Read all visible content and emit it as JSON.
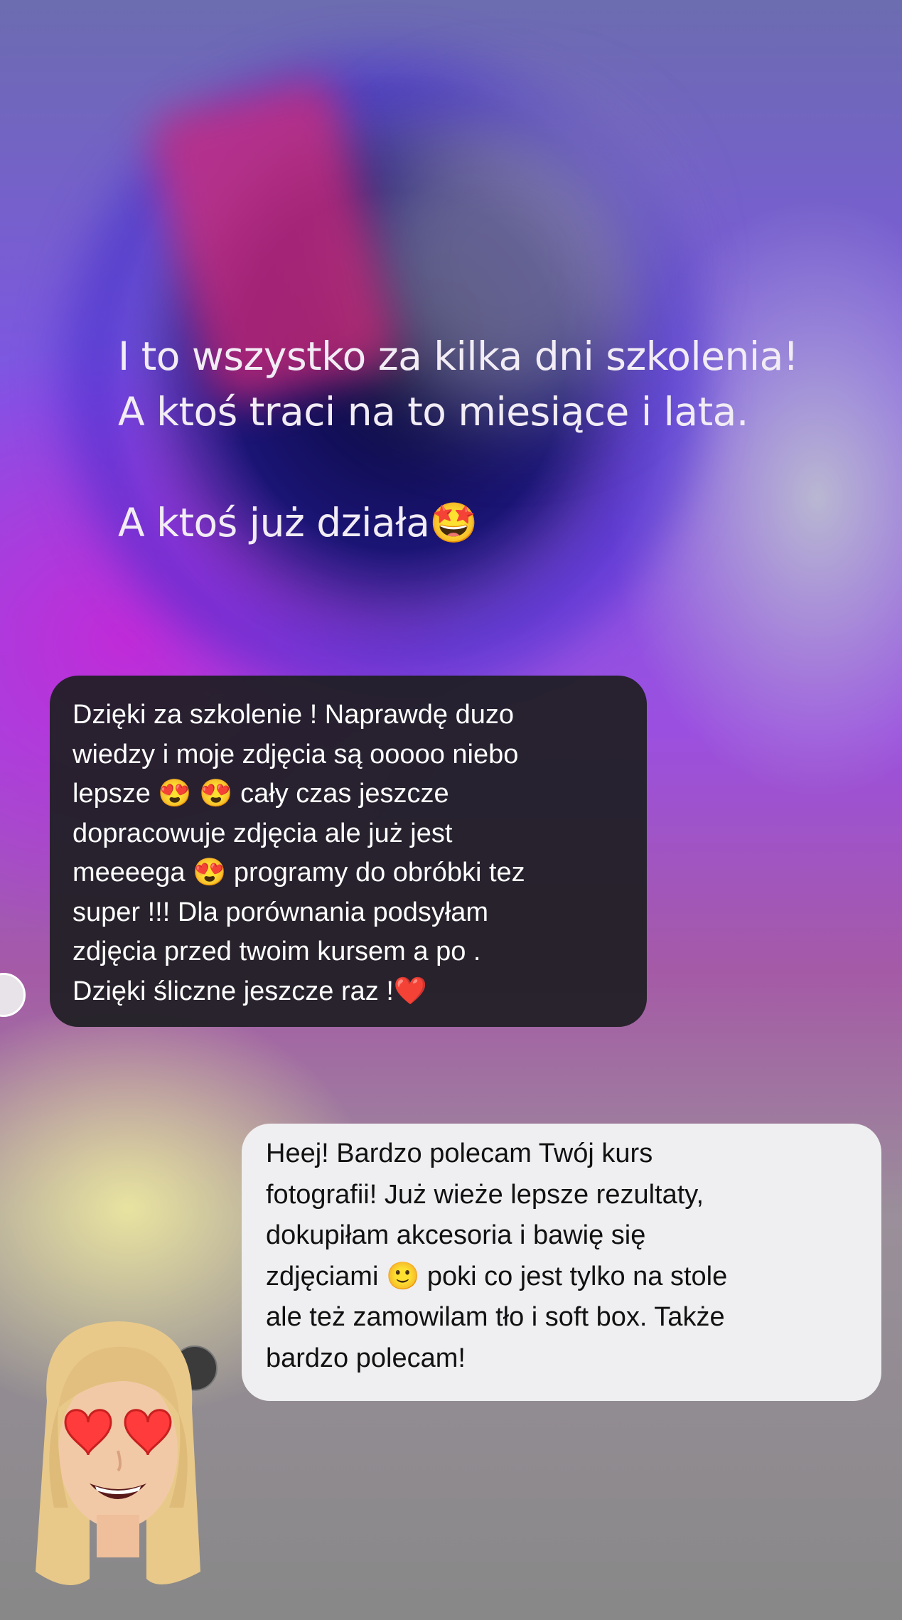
{
  "story": {
    "line1": "I to wszystko za kilka dni szkolenia!",
    "line2": "A ktoś traci na to miesiące i lata.",
    "line3": "A ktoś już działa🤩"
  },
  "message_received": {
    "lines": [
      "Dzięki za szkolenie ! Naprawdę duzo",
      "wiedzy i moje zdjęcia są ooooo niebo",
      "lepsze 😍 😍 cały czas jeszcze",
      "dopracowuje zdjęcia ale już jest",
      "meeeega 😍 programy do obróbki tez",
      "super !!! Dla porównania podsyłam",
      "zdjęcia przed twoim kursem a po .",
      "Dzięki śliczne jeszcze raz !❤️"
    ]
  },
  "message_reply": {
    "lines": [
      "Heej! Bardzo polecam Twój kurs",
      "fotografii! Już wieże lepsze rezultaty,",
      "dokupiłam akcesoria i bawię się",
      "zdjęciami 🙂 poki co jest tylko na stole",
      "ale też zamowilam tło i soft box. Także",
      "bardzo polecam!"
    ]
  },
  "colors": {
    "dark_bubble": "#1e1e22",
    "light_bubble": "#efeff1",
    "story_text": "#f2ecf5"
  },
  "icons": {
    "sender_avatar": "avatar",
    "reply_avatar": "avatar",
    "memoji": "heart-eyes-memoji"
  }
}
